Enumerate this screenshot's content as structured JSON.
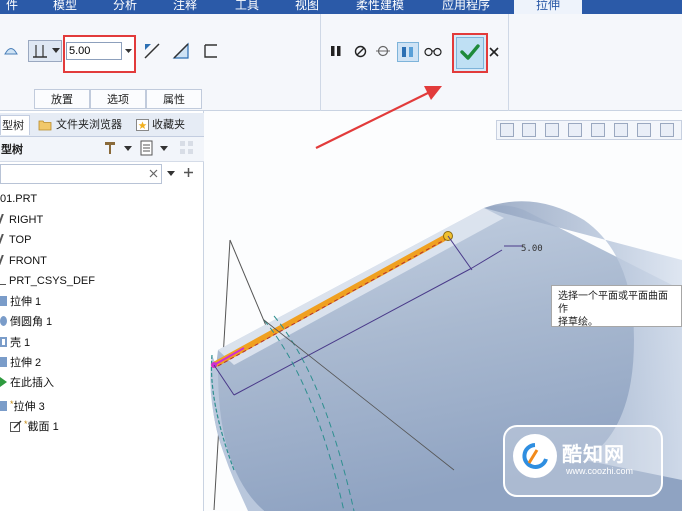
{
  "menu": {
    "tabs": [
      "件",
      "模型",
      "分析",
      "注释",
      "工具",
      "视图",
      "柔性建模",
      "应用程序",
      "拉伸"
    ]
  },
  "ribbon": {
    "depth_value": "5.00",
    "panel_tabs": [
      "放置",
      "选项",
      "属性"
    ]
  },
  "tree": {
    "tabs": [
      "型树",
      "文件夹浏览器",
      "收藏夹"
    ],
    "header": "型树",
    "items": [
      "01.PRT",
      "RIGHT",
      "TOP",
      "FRONT",
      "PRT_CSYS_DEF",
      "拉伸 1",
      "倒圆角 1",
      "壳 1",
      "拉伸 2",
      "在此插入",
      "拉伸 3",
      "截面 1"
    ]
  },
  "viewport": {
    "dimension_label": "5.00",
    "tooltip": "选择一个平面或平面曲面作\n择草绘。"
  },
  "watermark": {
    "brand": "酷知网",
    "url": "www.coozhi.com"
  },
  "colors": {
    "menubar": "#2b5aa8",
    "highlight_box": "#e23b3b",
    "edge_highlight": "#f0a020",
    "check": "#1e8a3a"
  }
}
